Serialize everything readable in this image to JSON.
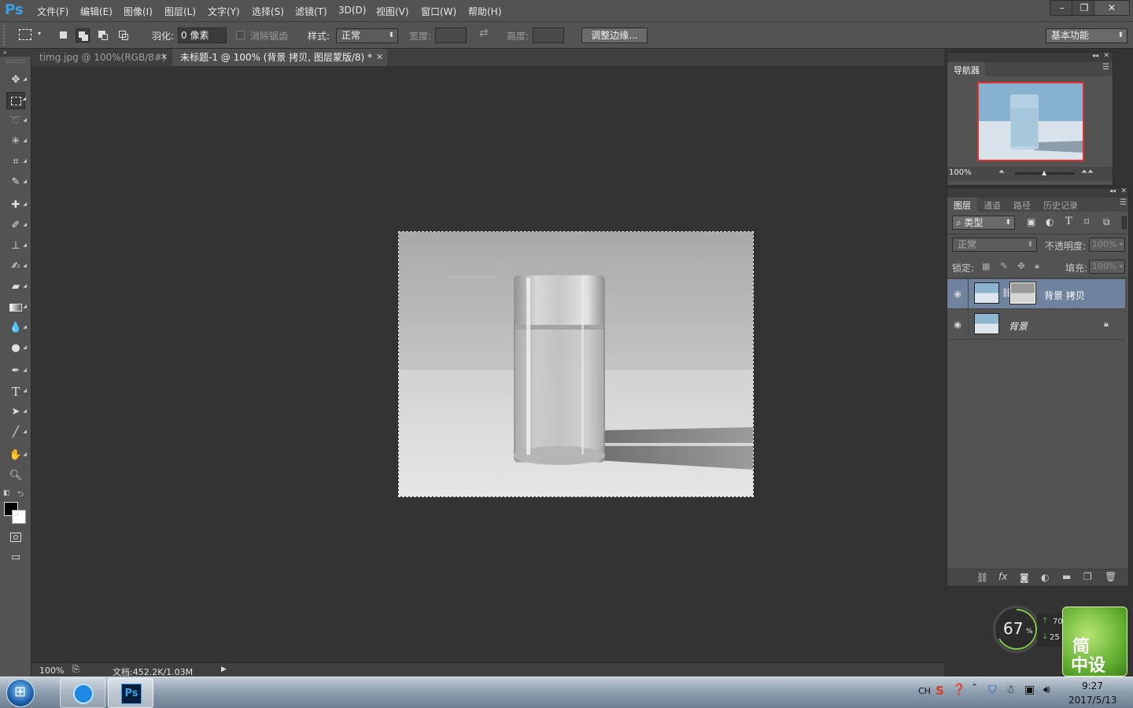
{
  "app": {
    "logo": "Ps",
    "menu": [
      "文件(F)",
      "编辑(E)",
      "图像(I)",
      "图层(L)",
      "文字(Y)",
      "选择(S)",
      "滤镜(T)",
      "3D(D)",
      "视图(V)",
      "窗口(W)",
      "帮助(H)"
    ]
  },
  "window_controls": {
    "minimize": "–",
    "restore": "❐",
    "close": "✕"
  },
  "options_bar": {
    "feather_label": "羽化:",
    "feather_value": "0 像素",
    "antialias_label": "消除锯齿",
    "style_label": "样式:",
    "style_value": "正常",
    "width_label": "宽度:",
    "height_label": "高度:",
    "refine_edge_label": "调整边缘...",
    "workspace_value": "基本功能"
  },
  "tabs": [
    {
      "label": "timg.jpg @ 100%(RGB/8#)",
      "active": false
    },
    {
      "label": "未标题-1 @ 100% (背景 拷贝, 图层蒙版/8) *",
      "active": true
    }
  ],
  "tools": [
    "move-tool",
    "rect-marquee-tool",
    "lasso-tool",
    "magic-wand-tool",
    "crop-tool",
    "eyedropper-tool",
    "healing-brush-tool",
    "brush-tool",
    "clone-stamp-tool",
    "history-brush-tool",
    "eraser-tool",
    "gradient-tool",
    "blur-tool",
    "dodge-tool",
    "pen-tool",
    "type-tool",
    "path-selection-tool",
    "line-tool",
    "hand-tool",
    "zoom-tool"
  ],
  "colors": {
    "foreground": "#000000",
    "background": "#ffffff",
    "layer_selected": "#6f829e",
    "accent": "#3aa0ea"
  },
  "status": {
    "zoom": "100%",
    "doc_info": "文档:452.2K/1.03M"
  },
  "navigator": {
    "title": "导航器",
    "zoom": "100%",
    "zoom_slider_level": 0.5
  },
  "layers_panel": {
    "tabs": [
      {
        "label": "图层",
        "active": true
      },
      {
        "label": "通道",
        "active": false
      },
      {
        "label": "路径",
        "active": false
      },
      {
        "label": "历史记录",
        "active": false
      }
    ],
    "filter_value": "类型",
    "blend_mode": "正常",
    "opacity_label": "不透明度:",
    "opacity_value": "100%",
    "lock_label": "锁定:",
    "fill_label": "填充:",
    "fill_value": "100%",
    "layers": [
      {
        "name": "背景 拷贝",
        "selected": true,
        "has_mask": true,
        "locked": false
      },
      {
        "name": "背景",
        "selected": false,
        "has_mask": false,
        "locked": true
      }
    ]
  },
  "widget": {
    "percent": "67",
    "percent_sign": "%",
    "up_value": "70",
    "down_value": "25",
    "badge_text_1": "简",
    "badge_text_2": "中设"
  },
  "taskbar": {
    "ime": "CH",
    "time": "9:27",
    "date": "2017/5/13",
    "ps_label": "Ps"
  }
}
